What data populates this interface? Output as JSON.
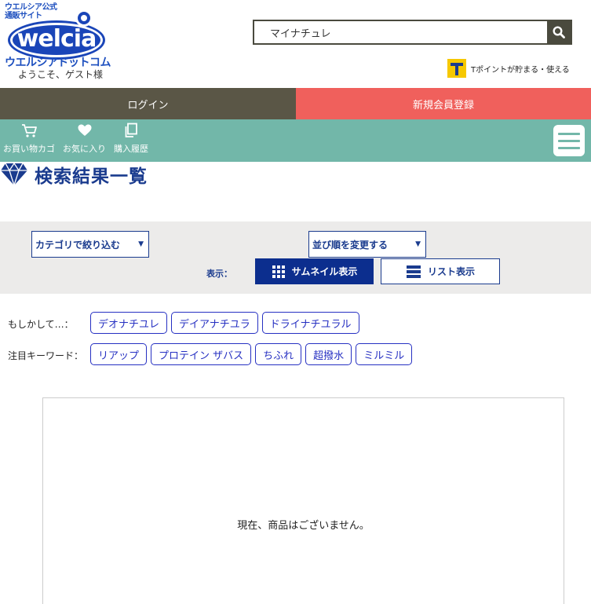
{
  "header": {
    "logo_tagline": "ウエルシア公式\n通販サイト",
    "logo_word": "welcia",
    "logo_kana": "ウエルシアドットコム",
    "welcome": "ようこそ、ゲスト様",
    "search_value": "マイナチュレ",
    "tpoint_text": "Tポイントが貯まる・使える"
  },
  "auth": {
    "login": "ログイン",
    "register": "新規会員登録"
  },
  "nav": {
    "cart": "お買い物カゴ",
    "favorites": "お気に入り",
    "history": "購入履歴"
  },
  "page_title": "検索結果一覧",
  "filter": {
    "category_select": "カテゴリで絞り込む",
    "sort_select": "並び順を変更する",
    "view_label": "表示：",
    "thumbnail_view": "サムネイル表示",
    "list_view": "リスト表示"
  },
  "suggestions": {
    "label": "もしかして…：",
    "items": [
      "デオナチユレ",
      "デイアナチユラ",
      "ドライナチユラル"
    ]
  },
  "featured": {
    "label": "注目キーワード：",
    "items": [
      "リアップ",
      "プロテイン ザバス",
      "ちふれ",
      "超撥水",
      "ミルミル"
    ]
  },
  "result_message": "現在、商品はございません。",
  "colors": {
    "brand_blue": "#1a45b8",
    "navy": "#0c2e8e",
    "login_bg": "#5a5646",
    "register_bg": "#f0605c",
    "nav_bg": "#72b7a9",
    "filter_bg": "#ecebea"
  }
}
